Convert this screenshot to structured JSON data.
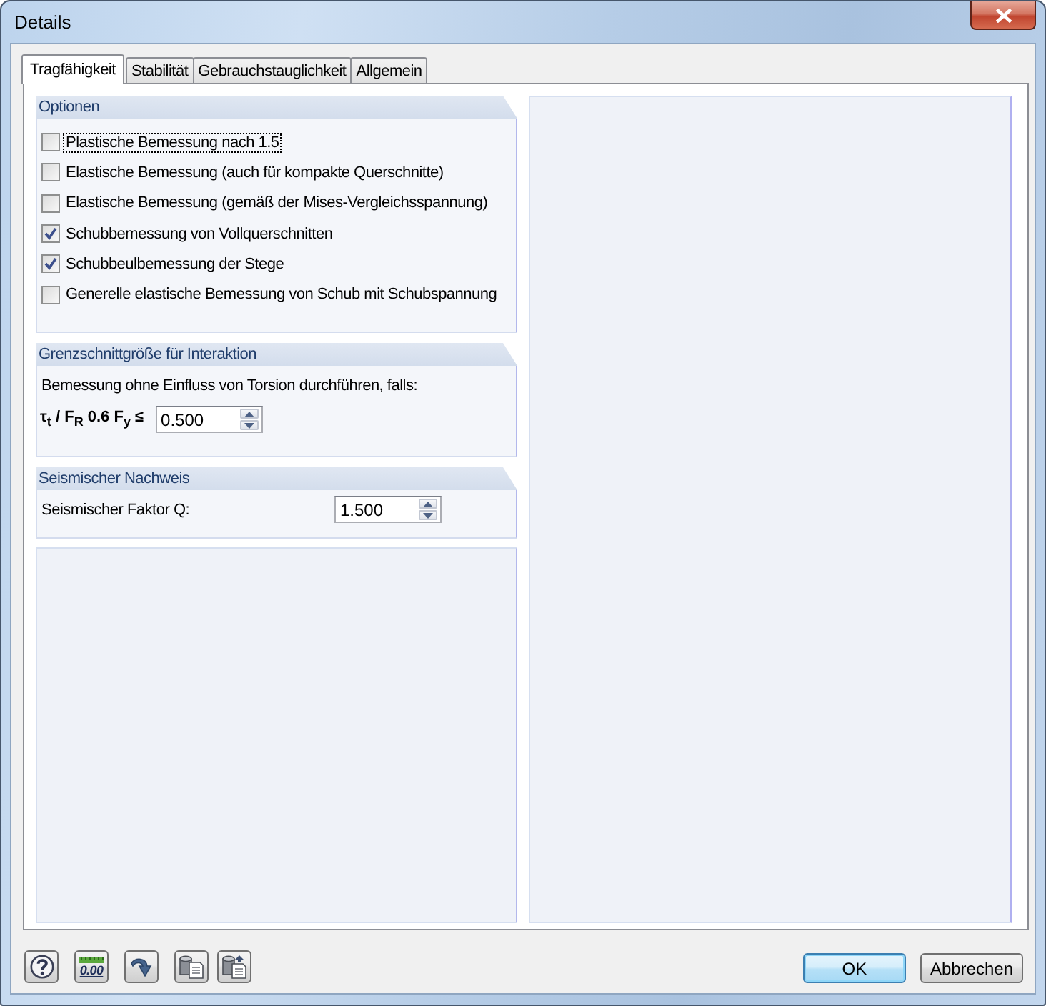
{
  "window": {
    "title": "Details"
  },
  "tabs": [
    {
      "label": "Tragfähigkeit",
      "selected": true
    },
    {
      "label": "Stabilität",
      "selected": false
    },
    {
      "label": "Gebrauchstauglichkeit",
      "selected": false
    },
    {
      "label": "Allgemein",
      "selected": false
    }
  ],
  "options": {
    "title": "Optionen",
    "items": [
      {
        "label": "Plastische Bemessung nach 1.5",
        "checked": false,
        "focused": true
      },
      {
        "label": "Elastische Bemessung (auch für kompakte Querschnitte)",
        "checked": false,
        "focused": false
      },
      {
        "label": "Elastische Bemessung (gemäß der Mises-Vergleichsspannung)",
        "checked": false,
        "focused": false
      },
      {
        "label": "Schubbemessung von Vollquerschnitten",
        "checked": true,
        "focused": false
      },
      {
        "label": "Schubbeulbemessung der Stege",
        "checked": true,
        "focused": false
      },
      {
        "label": "Generelle elastische Bemessung von Schub mit Schubspannung",
        "checked": false,
        "focused": false
      }
    ]
  },
  "interaction": {
    "title": "Grenzschnittgröße für Interaktion",
    "note": "Bemessung ohne Einfluss von Torsion durchführen, falls:",
    "label": "τ$_{t}$ / F$_{R}$ 0.6 F$_{y}$ ≤",
    "value": "0.500"
  },
  "seismic": {
    "title": "Seismischer Nachweis",
    "label": "Seismischer Faktor Q:",
    "value": "1.500"
  },
  "toolbar": [
    {
      "kind": "help"
    },
    {
      "kind": "decimals",
      "label": "0.00"
    },
    {
      "kind": "arrow"
    },
    {
      "kind": "export"
    },
    {
      "kind": "import"
    }
  ],
  "buttons": [
    {
      "label": "OK",
      "default": true
    },
    {
      "label": "Abbrechen",
      "default": false
    }
  ]
}
